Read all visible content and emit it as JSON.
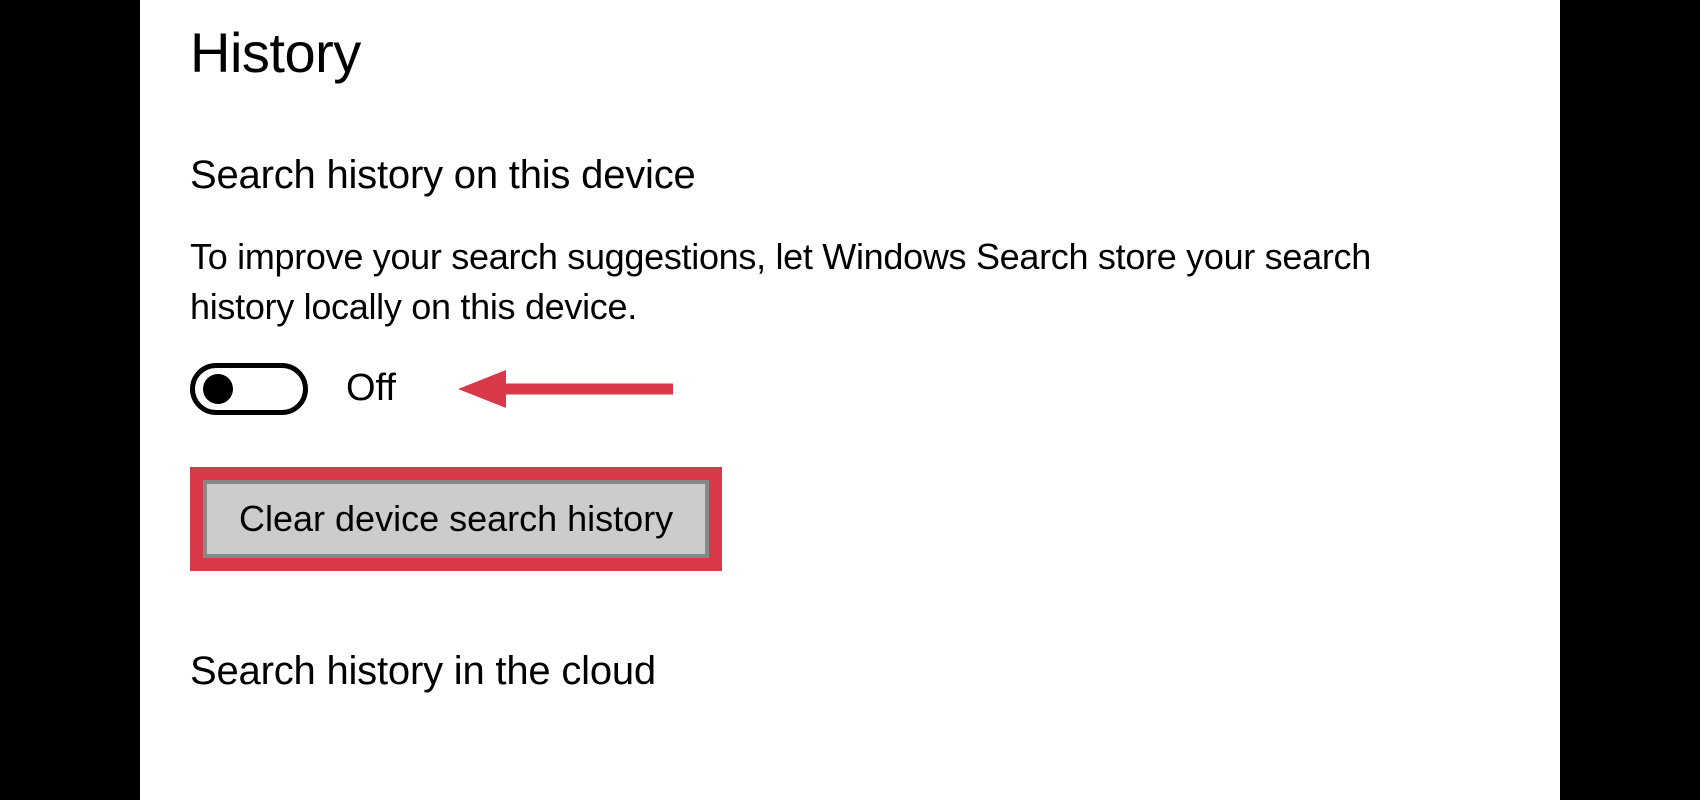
{
  "section_title": "History",
  "device_section": {
    "heading": "Search history on this device",
    "description": "To improve your search suggestions, let Windows Search store your search history locally on this device.",
    "toggle_state": "Off",
    "clear_button_label": "Clear device search history"
  },
  "cloud_section": {
    "heading": "Search history in the cloud"
  },
  "annotation": {
    "highlight_color": "#d93a4a",
    "arrow_color": "#d93a4a"
  }
}
